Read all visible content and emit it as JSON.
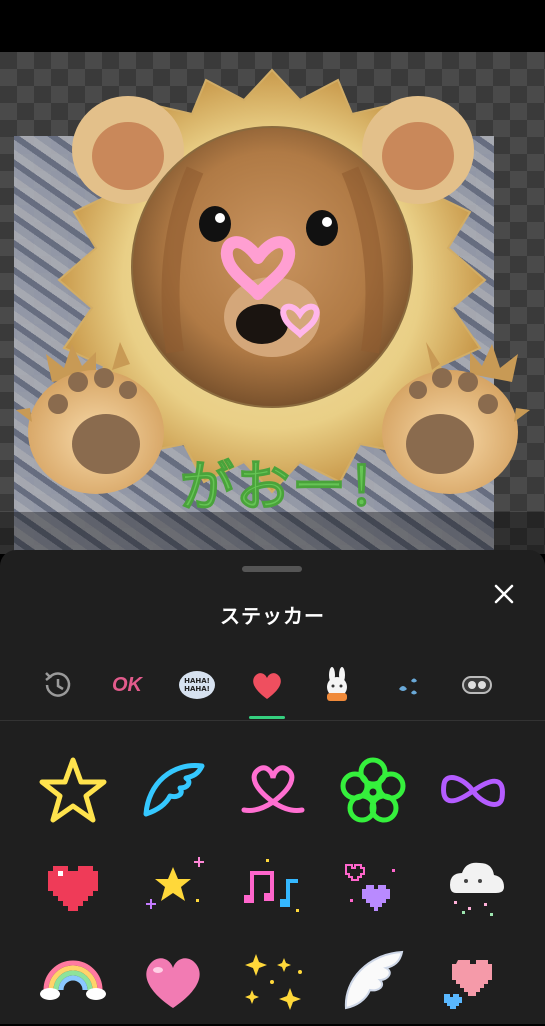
{
  "editor": {
    "caption_text": "がおー！"
  },
  "sheet": {
    "title": "ステッカー"
  },
  "tabs": [
    {
      "icon": "history-icon"
    },
    {
      "icon": "ok-sticker-icon",
      "label": "OK"
    },
    {
      "icon": "haha-bubble-icon",
      "label": "HAHA! HAHA!"
    },
    {
      "icon": "heart-icon",
      "selected": true
    },
    {
      "icon": "rabbit-icon"
    },
    {
      "icon": "drops-icon"
    },
    {
      "icon": "eyes-icon"
    }
  ],
  "stickers": [
    "neon-star",
    "neon-wing",
    "neon-heart-ribbon",
    "neon-flower",
    "neon-bow",
    "pixel-heart-red",
    "pixel-stars",
    "pixel-music-notes",
    "pixel-hearts-purple",
    "pixel-cloud",
    "pixel-rainbow",
    "pink-heart",
    "gold-sparkles",
    "white-wing",
    "pixel-heart-pink"
  ],
  "colors": {
    "accent": "#35d07f",
    "sheet_bg": "#1f1f1f",
    "caption": "#66c455"
  }
}
